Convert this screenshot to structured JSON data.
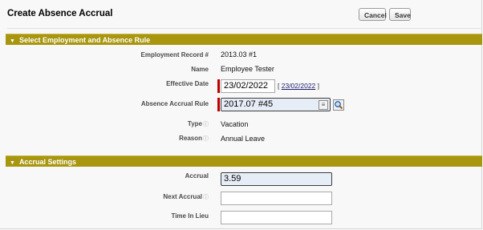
{
  "page": {
    "title": "Create Absence Accrual",
    "cancel_label": "Cancel",
    "save_label": "Save"
  },
  "section_employment": {
    "title": "Select Employment and Absence Rule",
    "employment_record": {
      "label": "Employment Record #",
      "value": "2013.03 #1"
    },
    "name": {
      "label": "Name",
      "value": "Employee Tester"
    },
    "effective_date": {
      "label": "Effective Date",
      "value": "23/02/2022",
      "today_link": "23/02/2022"
    },
    "absence_accrual_rule": {
      "label": "Absence Accrual Rule",
      "value": "2017.07 #45"
    },
    "type": {
      "label": "Type",
      "value": "Vacation"
    },
    "reason": {
      "label": "Reason",
      "value": "Annual Leave"
    }
  },
  "section_accrual": {
    "title": "Accrual Settings",
    "accrual": {
      "label": "Accrual",
      "value": "3.59"
    },
    "next_accrual": {
      "label": "Next Accrual",
      "value": ""
    },
    "time_in_lieu": {
      "label": "Time In Lieu",
      "value": ""
    }
  },
  "icons": {
    "section_toggle": "triangle-down-icon",
    "help": "info-circle-icon",
    "lookup": "magnifier-icon",
    "picker": "list-picker-icon"
  },
  "colors": {
    "section_header": "#a8960f",
    "required_marker": "#c00000",
    "filled_field": "#e7edf6"
  }
}
